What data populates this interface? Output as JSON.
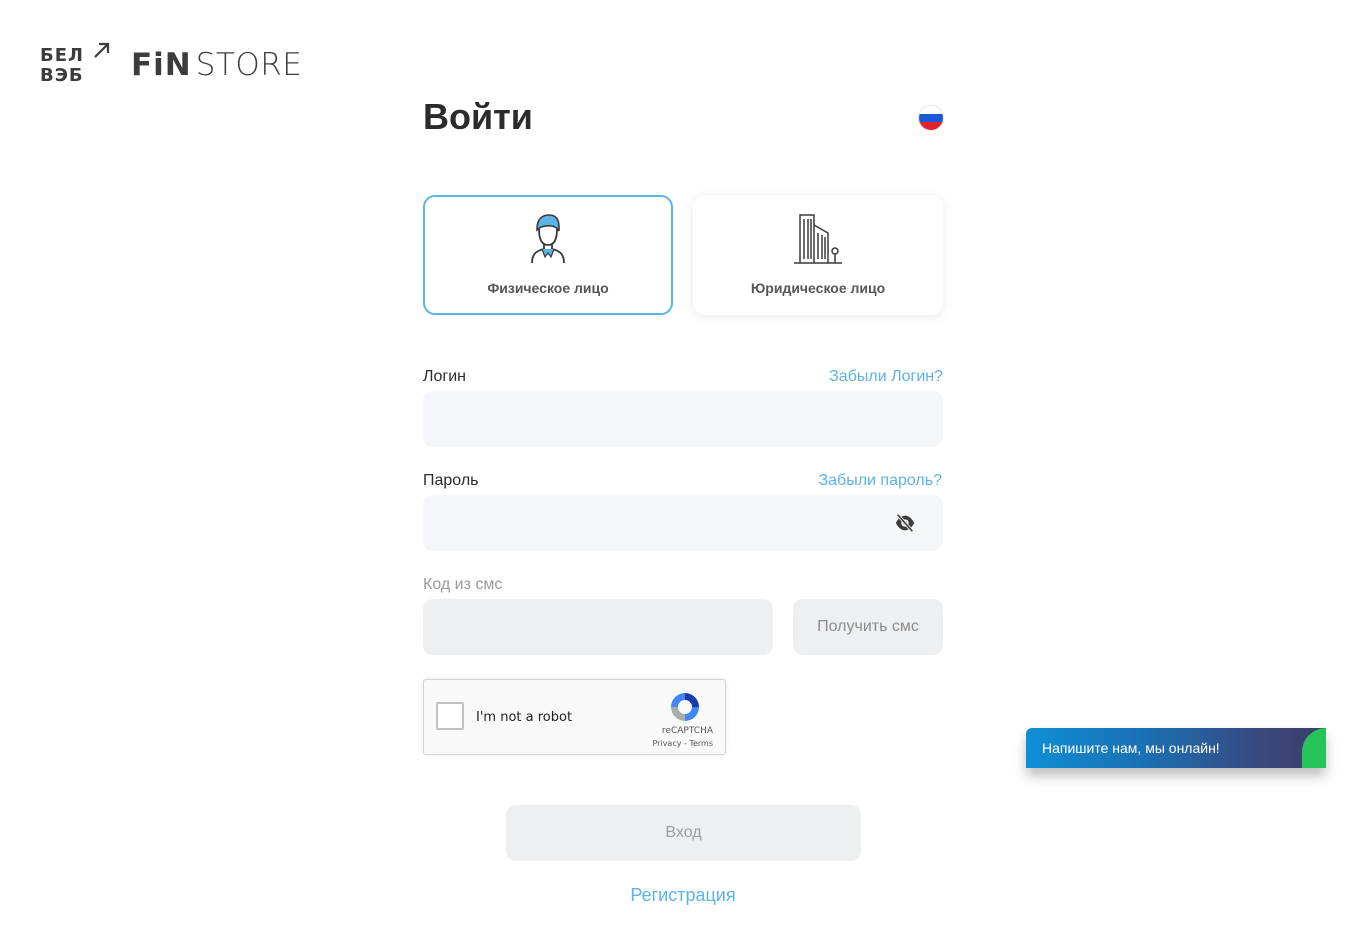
{
  "brand": {
    "logo1_line1": "БЕЛ",
    "logo1_line2": "ВЭБ",
    "logo2_fin": "FiN",
    "logo2_store": "STORE"
  },
  "page": {
    "title": "Войти",
    "language_flag": "ru-flag-icon"
  },
  "account_types": [
    {
      "label": "Физическое лицо",
      "icon": "person-icon",
      "selected": true
    },
    {
      "label": "Юридическое лицо",
      "icon": "building-icon",
      "selected": false
    }
  ],
  "form": {
    "login_label": "Логин",
    "forgot_login": "Забыли Логин?",
    "login_value": "",
    "password_label": "Пароль",
    "forgot_password": "Забыли пароль?",
    "password_value": "",
    "sms_label": "Код из смс",
    "sms_value": "",
    "get_sms": "Получить смс",
    "submit": "Вход",
    "register": "Регистрация"
  },
  "captcha": {
    "text": "I'm not a robot",
    "brand": "reCAPTCHA",
    "links": "Privacy - Terms"
  },
  "chat": {
    "text": "Напишите нам, мы онлайн!"
  },
  "colors": {
    "accent": "#5cb3e6",
    "input_bg": "#f5f6fa",
    "disabled_bg": "#eeeff1"
  }
}
